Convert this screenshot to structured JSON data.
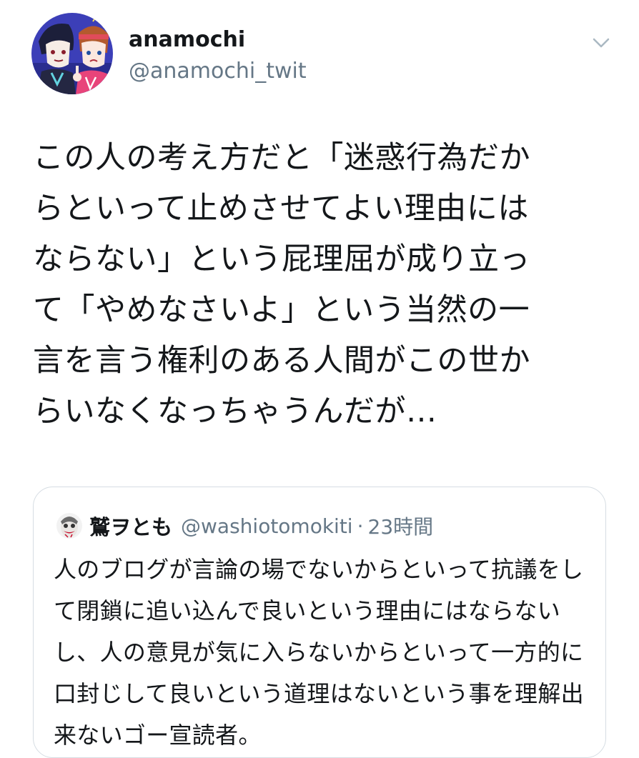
{
  "author": {
    "display_name": "anamochi",
    "handle": "@anamochi_twit",
    "avatar_icon": "profile-avatar-illustration"
  },
  "menu": {
    "icon": "chevron-down-icon"
  },
  "tweet": {
    "lines": [
      "この人の考え方だと「迷惑行為だか",
      "らといって止めさせてよい理由には",
      "ならない」という屁理屈が成り立っ",
      "て「やめなさいよ」という当然の一",
      "言を言う権利のある人間がこの世か",
      "らいなくなっちゃうんだが…"
    ]
  },
  "quoted_tweet": {
    "display_name": "鷲ヲとも",
    "handle": "@washiotomokiti",
    "separator": "·",
    "time": "23時間",
    "avatar_icon": "quoted-avatar-clown",
    "lines": [
      "人のブログが言論の場でないからといって抗議をし",
      "て閉鎖に追い込んで良いという理由にはならない",
      "し、人の意見が気に入らないからといって一方的に",
      "口封じして良いという道理はないという事を理解出",
      "来ないゴー宣読者。"
    ]
  },
  "colors": {
    "text_primary": "#14171a",
    "text_secondary": "#657786",
    "border": "#d6dde3",
    "background": "#ffffff"
  }
}
